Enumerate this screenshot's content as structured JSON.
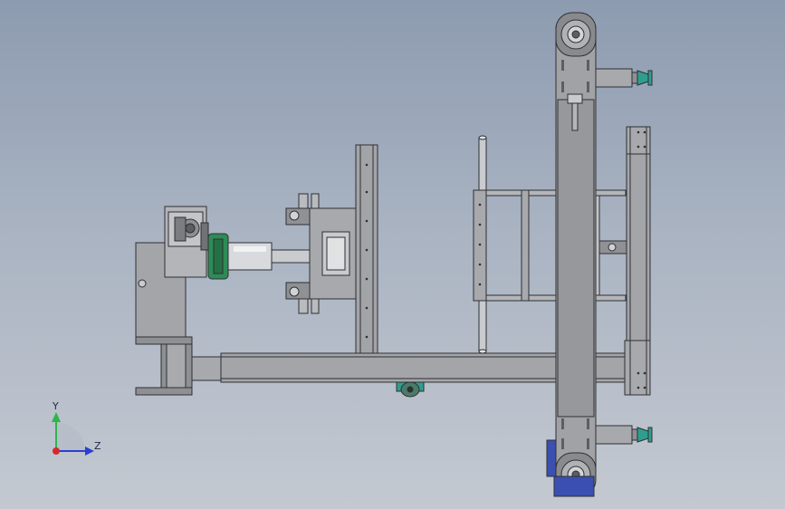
{
  "viewport": {
    "background_top": "#8d9bb0",
    "background_bottom": "#c4c9d1"
  },
  "colors": {
    "steel": "#9ea0a3",
    "steel_dark": "#6f7276",
    "outline": "#2e3033",
    "shaft": "#d8dadd",
    "green_flange": "#2e8b57",
    "teal_pad": "#2f9e8f",
    "blue_motor": "#3a4fb0"
  },
  "triad": {
    "y_label": "Y",
    "z_label": "Z",
    "y_color": "#2db54a",
    "z_color": "#2a3fd1",
    "origin_color": "#d42a2a"
  }
}
